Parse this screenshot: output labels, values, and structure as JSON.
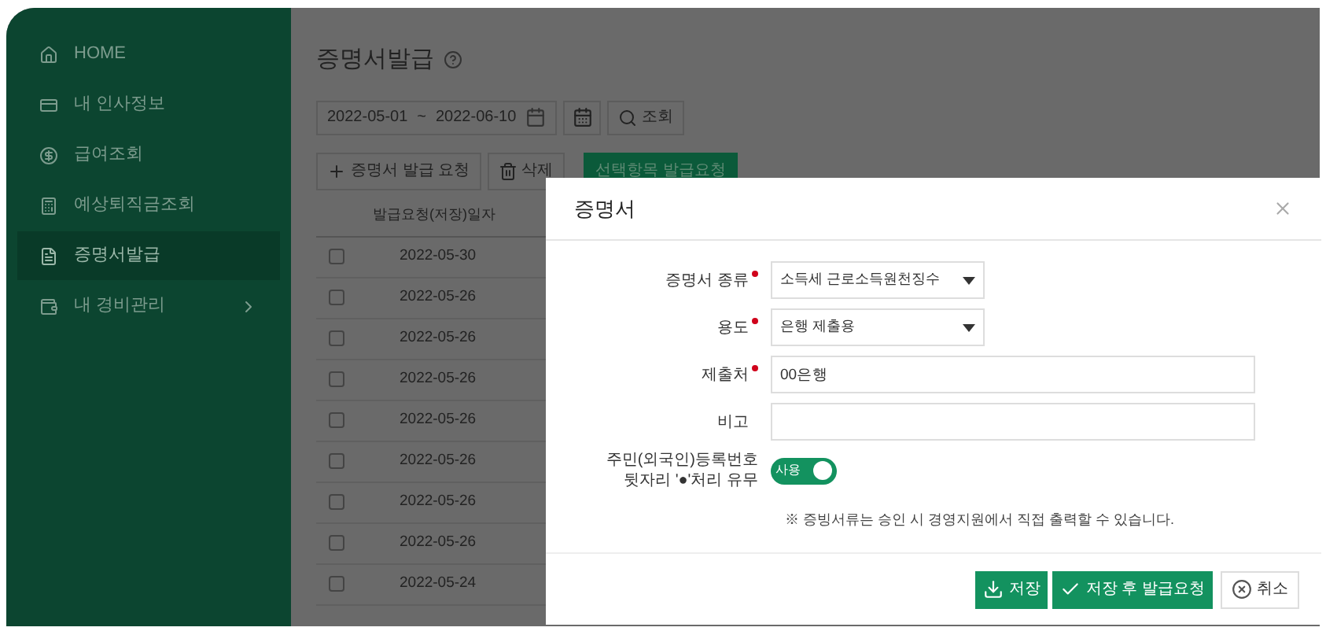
{
  "sidebar": {
    "items": [
      {
        "kind": "home",
        "label": "HOME",
        "selected": false
      },
      {
        "kind": "card",
        "label": "내 인사정보",
        "selected": false
      },
      {
        "kind": "coin",
        "label": "급여조회",
        "selected": false
      },
      {
        "kind": "calc",
        "label": "예상퇴직금조회",
        "selected": false
      },
      {
        "kind": "doc",
        "label": "증명서발급",
        "selected": true
      },
      {
        "kind": "wallet",
        "label": "내 경비관리",
        "selected": false,
        "has_submenu": true
      }
    ]
  },
  "page": {
    "title": "증명서발급",
    "date_from": "2022-05-01",
    "date_sep": "~",
    "date_to": "2022-06-10",
    "search_button": "조회",
    "actions": {
      "add": "증명서 발급 요청",
      "delete": "삭제",
      "bulk": "선택항목 발급요청"
    },
    "table": {
      "columns": [
        "발급요청(저장)일자"
      ],
      "rows": [
        {
          "date": "2022-05-30",
          "checked": false
        },
        {
          "date": "2022-05-26",
          "checked": false
        },
        {
          "date": "2022-05-26",
          "checked": false
        },
        {
          "date": "2022-05-26",
          "checked": false
        },
        {
          "date": "2022-05-26",
          "checked": false
        },
        {
          "date": "2022-05-26",
          "checked": false
        },
        {
          "date": "2022-05-26",
          "checked": false
        },
        {
          "date": "2022-05-26",
          "checked": false
        },
        {
          "date": "2022-05-24",
          "checked": false
        }
      ]
    }
  },
  "dialog": {
    "title": "증명서",
    "fields": [
      {
        "kind": "select",
        "label": "증명서 종류",
        "required": true,
        "value": "소득세 근로소득원천징수"
      },
      {
        "kind": "select",
        "label": "용도",
        "required": true,
        "value": "은행 제출용"
      },
      {
        "kind": "text",
        "label": "제출처",
        "required": true,
        "value": "00은행"
      },
      {
        "kind": "text",
        "label": "비고",
        "required": false
      },
      {
        "kind": "toggle",
        "label_lines": [
          "주민(외국인)등록번호",
          "뒷자리 '●'처리 유무"
        ],
        "on": true,
        "toggle_label": "사용"
      }
    ],
    "note": "※ 증빙서류는 승인 시 경영지원에서 직접 출력할 수 있습니다.",
    "buttons": [
      {
        "kind": "save",
        "label": "저장"
      },
      {
        "kind": "save_request",
        "label": "저장 후 발급요청"
      },
      {
        "kind": "cancel",
        "label": "취소"
      }
    ]
  }
}
